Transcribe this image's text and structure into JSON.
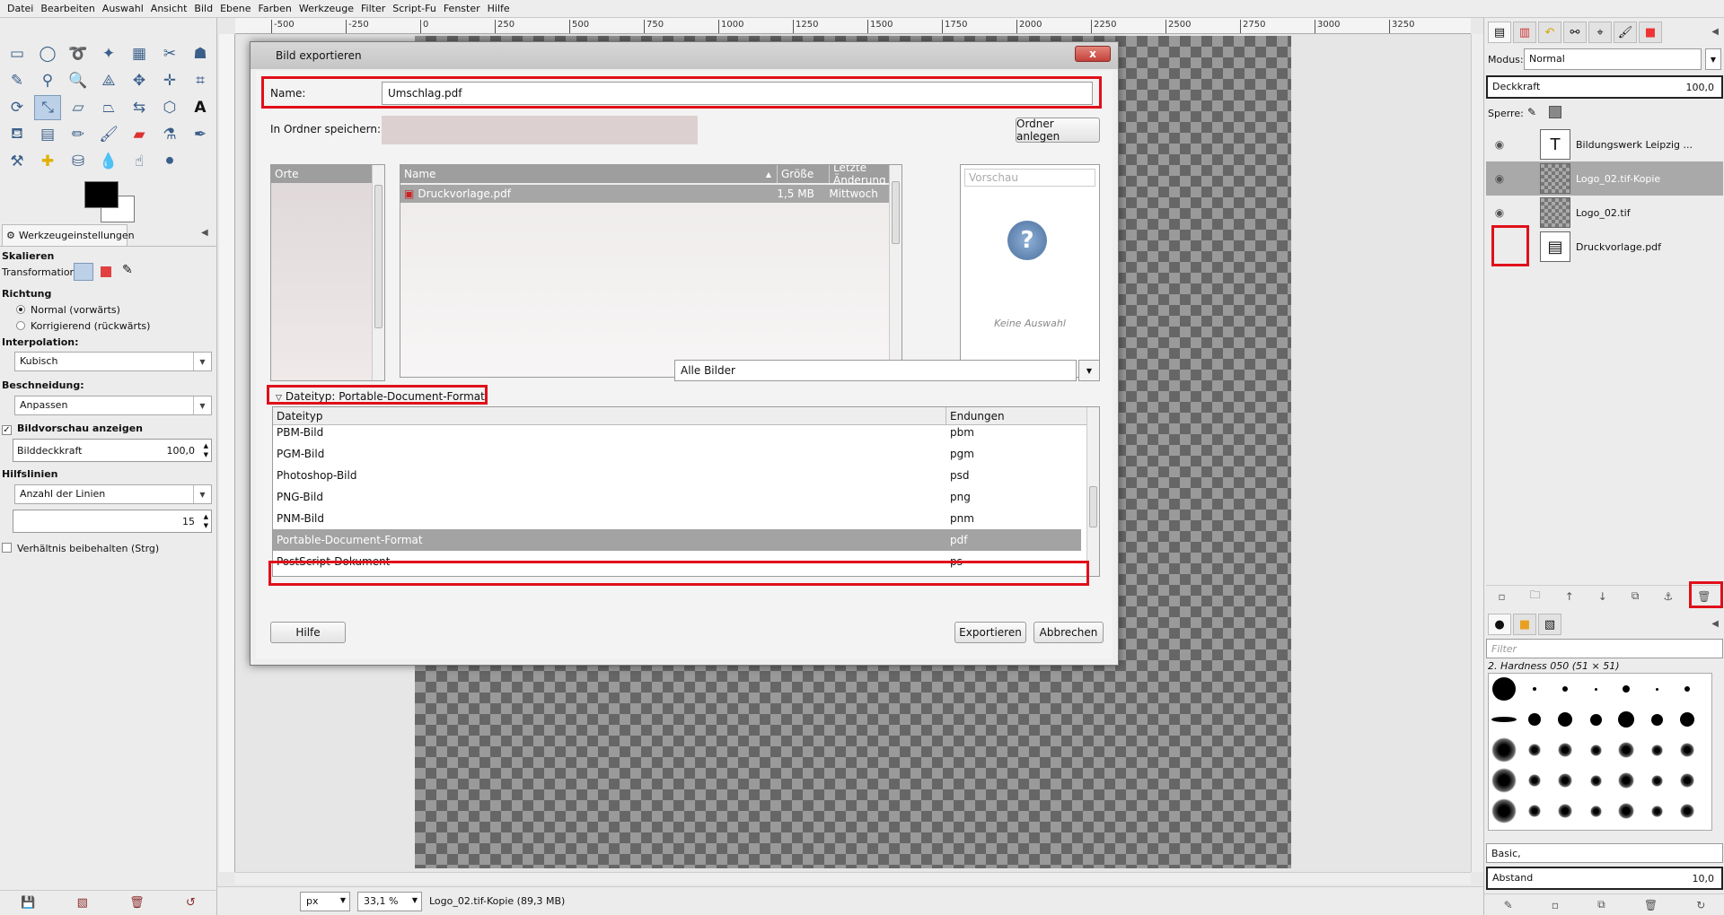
{
  "menu": [
    {
      "label": "Datei"
    },
    {
      "label": "Bearbeiten"
    },
    {
      "label": "Auswahl"
    },
    {
      "label": "Ansicht"
    },
    {
      "label": "Bild"
    },
    {
      "label": "Ebene"
    },
    {
      "label": "Farben"
    },
    {
      "label": "Werkzeuge"
    },
    {
      "label": "Filter"
    },
    {
      "label": "Script-Fu"
    },
    {
      "label": "Fenster"
    },
    {
      "label": "Hilfe"
    }
  ],
  "ruler_ticks": [
    "-500",
    "-250",
    "0",
    "250",
    "500",
    "750",
    "1000",
    "1250",
    "1500",
    "1750",
    "2000",
    "2250",
    "2500",
    "2750",
    "3000",
    "3250"
  ],
  "tool_options": {
    "tab_label": "Werkzeugeinstellungen",
    "tool_name": "Skalieren",
    "transformation_label": "Transformation:",
    "direction_label": "Richtung",
    "direction_normal": "Normal (vorwärts)",
    "direction_corrective": "Korrigierend (rückwärts)",
    "interpolation_label": "Interpolation:",
    "interpolation_value": "Kubisch",
    "clipping_label": "Beschneidung:",
    "clipping_value": "Anpassen",
    "preview_label": "Bildvorschau anzeigen",
    "opacity_label": "Bilddeckkraft",
    "opacity_value": "100,0",
    "guides_label": "Hilfslinien",
    "guides_value": "Anzahl der Linien",
    "lines_value": "15",
    "keep_ratio_label": "Verhältnis beibehalten (Strg)"
  },
  "statusbar": {
    "unit": "px",
    "zoom": "33,1 %",
    "info": "Logo_02.tif-Kopie (89,3 MB)"
  },
  "layers_panel": {
    "mode_label": "Modus:",
    "mode_value": "Normal",
    "opacity_label": "Deckkraft",
    "opacity_value": "100,0",
    "lock_label": "Sperre:",
    "layers": [
      {
        "name": "Bildungswerk Leipzig ...",
        "visible": true,
        "selected": false
      },
      {
        "name": "Logo_02.tif-Kopie",
        "visible": true,
        "selected": true
      },
      {
        "name": "Logo_02.tif",
        "visible": true,
        "selected": false
      },
      {
        "name": "Druckvorlage.pdf",
        "visible": false,
        "selected": false
      }
    ]
  },
  "brushes_panel": {
    "filter_placeholder": "Filter",
    "brush_name": "2. Hardness 050 (51 × 51)",
    "preset": "Basic,",
    "spacing_label": "Abstand",
    "spacing_value": "10,0"
  },
  "dialog": {
    "title": "Bild exportieren",
    "close_label": "x",
    "name_label": "Name:",
    "name_value": "Umschlag.pdf",
    "folder_label": "In Ordner speichern:",
    "create_folder_label": "Ordner anlegen",
    "places_header": "Orte",
    "columns": {
      "name": "Name",
      "size": "Größe",
      "modified": "Letzte Änderung"
    },
    "files": [
      {
        "name": "Druckvorlage.pdf",
        "size": "1,5 MB",
        "modified": "Mittwoch"
      }
    ],
    "preview_header": "Vorschau",
    "preview_empty": "Keine Auswahl",
    "filter_value": "Alle Bilder",
    "filetype_expander": "Dateityp: Portable-Document-Format",
    "filetype_columns": {
      "type": "Dateityp",
      "ext": "Endungen"
    },
    "filetypes": [
      {
        "type": "PBM-Bild",
        "ext": "pbm",
        "selected": false
      },
      {
        "type": "PGM-Bild",
        "ext": "pgm",
        "selected": false
      },
      {
        "type": "Photoshop-Bild",
        "ext": "psd",
        "selected": false
      },
      {
        "type": "PNG-Bild",
        "ext": "png",
        "selected": false
      },
      {
        "type": "PNM-Bild",
        "ext": "pnm",
        "selected": false
      },
      {
        "type": "Portable-Document-Format",
        "ext": "pdf",
        "selected": true
      },
      {
        "type": "PostScript-Dokument",
        "ext": "ps",
        "selected": false
      }
    ],
    "help_label": "Hilfe",
    "export_label": "Exportieren",
    "cancel_label": "Abbrechen"
  },
  "colors": {
    "highlight": "#e0101a",
    "selection": "#a3a3a3"
  }
}
